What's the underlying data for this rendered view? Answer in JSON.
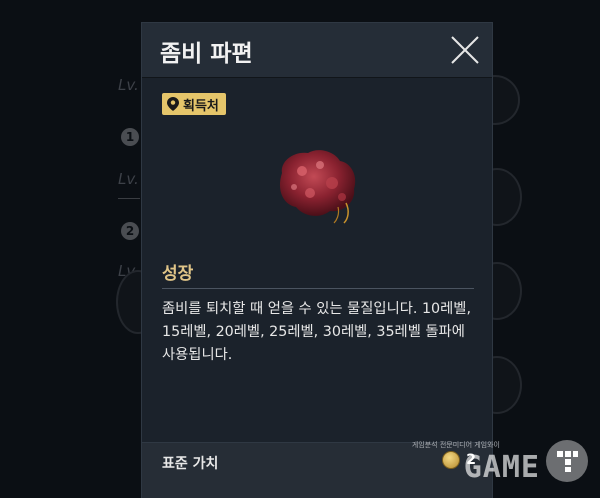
{
  "background": {
    "level_labels": [
      "Lv.",
      "Lv.",
      "Lv."
    ],
    "slot_numbers": [
      "1",
      "2"
    ]
  },
  "modal": {
    "title": "좀비 파편",
    "source_badge": {
      "label": "획득처",
      "icon": "map-pin-icon"
    },
    "item_image": {
      "name": "zombie-fragment",
      "color": "#8a2230"
    },
    "section_title": "성장",
    "description": "좀비를 퇴치할 때 얻을 수 있는 물질입니다. 10레벨, 15레벨, 20레벨, 25레벨, 30레벨, 35레벨 돌파에 사용됩니다.",
    "footer": {
      "label": "표준 가치",
      "value": "2",
      "currency_icon": "gold-coin-icon"
    },
    "close_icon": "close-icon"
  },
  "watermark": {
    "tagline": "게임분석 전문미디어 게임와이",
    "logo": "GAME"
  },
  "colors": {
    "badge": "#e5c56a",
    "section_title": "#e0c588",
    "modal_bg": "#1b222b",
    "header_bg": "#252d37"
  }
}
